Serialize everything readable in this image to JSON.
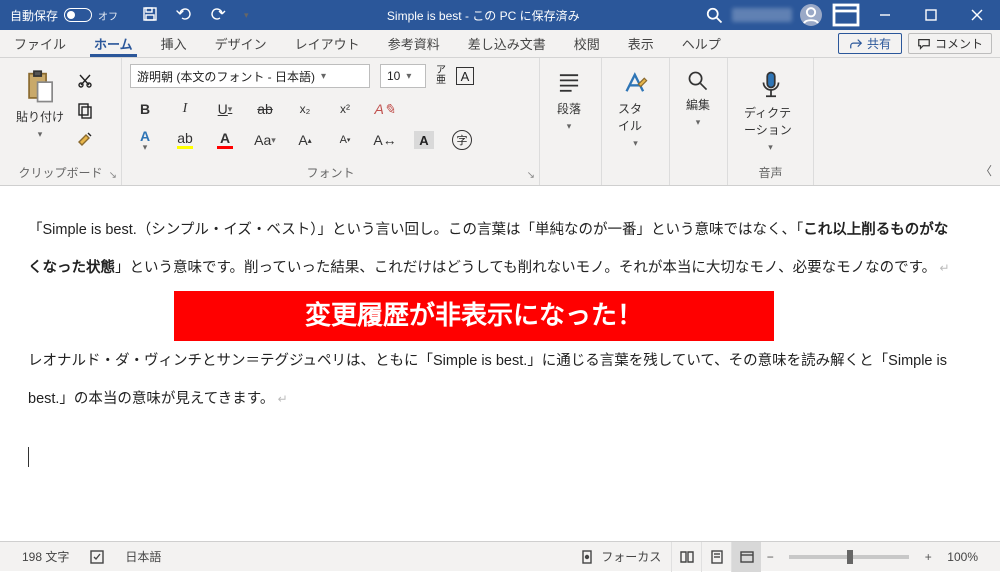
{
  "titlebar": {
    "auto_save_label": "自動保存",
    "toggle_text": "オフ",
    "title": "Simple is best - この PC に保存済み"
  },
  "tabs": {
    "items": [
      "ファイル",
      "ホーム",
      "挿入",
      "デザイン",
      "レイアウト",
      "参考資料",
      "差し込み文書",
      "校閲",
      "表示",
      "ヘルプ"
    ],
    "active_index": 1,
    "share": "共有",
    "comment": "コメント"
  },
  "ribbon": {
    "clipboard": {
      "label": "クリップボード",
      "paste": "貼り付け"
    },
    "font": {
      "label": "フォント",
      "name": "游明朝 (本文のフォント - 日本語)",
      "size": "10",
      "bold": "B",
      "italic": "I",
      "underline": "U",
      "strike": "ab",
      "sub": "x₂",
      "sup": "x²",
      "hl_char": "A",
      "color_char": "A",
      "char_a": "A",
      "aa": "Aa",
      "grow": "A^",
      "shrink": "A˅",
      "ruby": "ア亜",
      "boxed": "A",
      "enclosed": "字"
    },
    "paragraph": {
      "label": "段落"
    },
    "styles": {
      "label": "スタイル"
    },
    "editing": {
      "label": "編集"
    },
    "dictation": {
      "label_group": "音声",
      "label": "ディクテーション"
    }
  },
  "document": {
    "p1_a": "「Simple is best.（シンプル・イズ・ベスト）」という言い回し。この言葉は「単純なのが一番」という意味ではなく、「",
    "p1_b": "これ以上削るものがな",
    "p2_a": "くなった状態",
    "p2_b": "」という意味です。削っていった結果、これだけはどうしても削れないモノ。それが本当に大切なモノ、必要なモノなのです。",
    "banner": "変更履歴が非表示になった！",
    "p3": "レオナルド・ダ・ヴィンチとサン＝テグジュペリは、ともに「Simple is best.」に通じる言葉を残していて、その意味を読み解くと「Simple is",
    "p4": "best.」の本当の意味が見えてきます。"
  },
  "status": {
    "word_count": "198 文字",
    "language": "日本語",
    "focus": "フォーカス",
    "zoom": "100%"
  }
}
